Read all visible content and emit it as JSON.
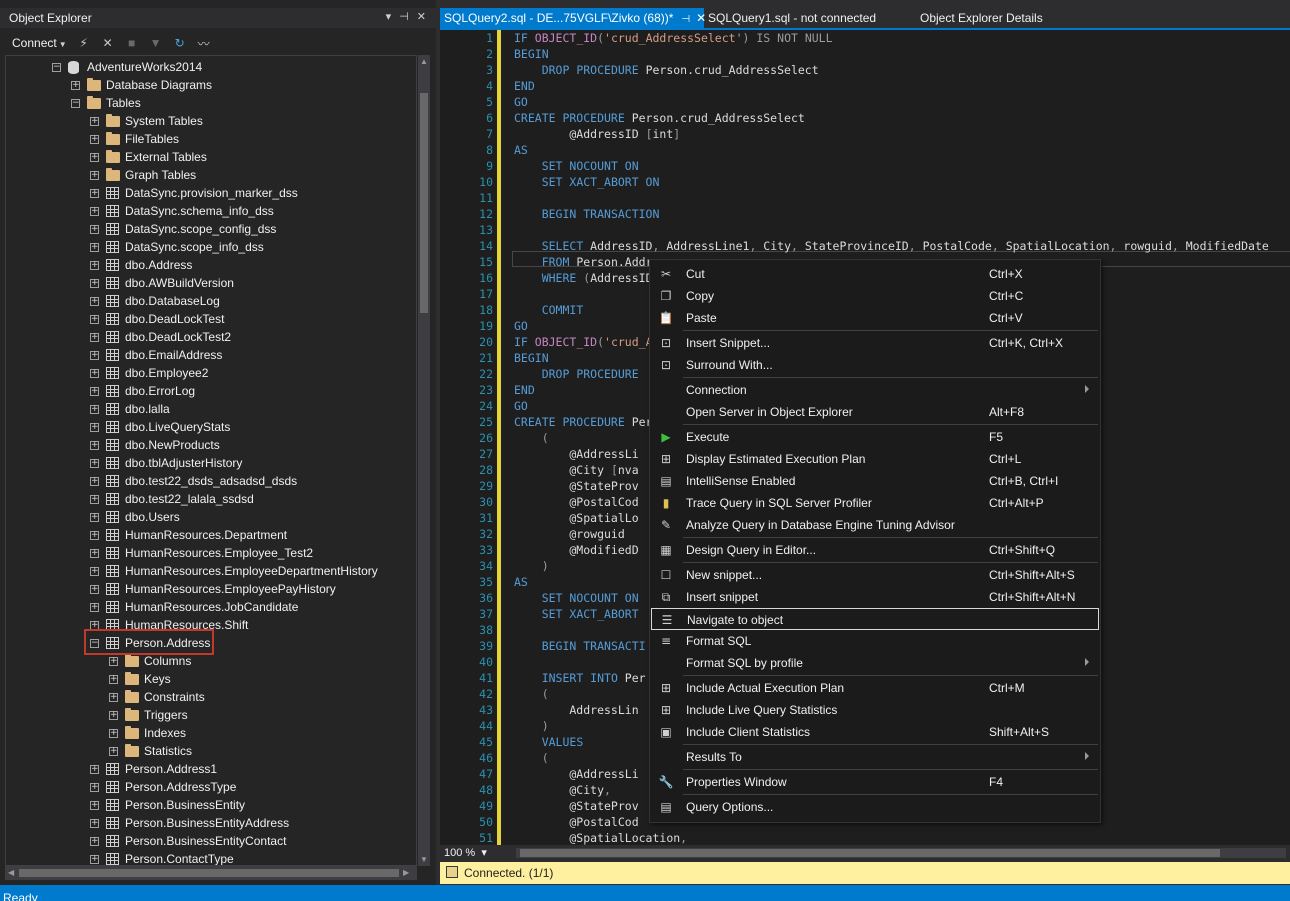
{
  "object_explorer": {
    "title": "Object Explorer",
    "pin_glyphs": [
      "▾",
      "⊣",
      "✕"
    ],
    "toolbar": {
      "connect_label": "Connect",
      "icons": [
        "connect-plug-icon",
        "disconnect-icon",
        "stop-icon",
        "filter-icon",
        "refresh-icon",
        "activity-monitor-icon"
      ]
    },
    "tree": [
      {
        "label": "AdventureWorks2014",
        "level": 0,
        "type": "db",
        "expander": "⊟"
      },
      {
        "label": "Database Diagrams",
        "level": 1,
        "type": "folder",
        "expander": "⊞"
      },
      {
        "label": "Tables",
        "level": 1,
        "type": "folder",
        "expander": "⊟"
      },
      {
        "label": "System Tables",
        "level": 2,
        "type": "folder",
        "expander": "⊞"
      },
      {
        "label": "FileTables",
        "level": 2,
        "type": "folder",
        "expander": "⊞"
      },
      {
        "label": "External Tables",
        "level": 2,
        "type": "folder",
        "expander": "⊞"
      },
      {
        "label": "Graph Tables",
        "level": 2,
        "type": "folder",
        "expander": "⊞"
      },
      {
        "label": "DataSync.provision_marker_dss",
        "level": 2,
        "type": "table",
        "expander": "⊞"
      },
      {
        "label": "DataSync.schema_info_dss",
        "level": 2,
        "type": "table",
        "expander": "⊞"
      },
      {
        "label": "DataSync.scope_config_dss",
        "level": 2,
        "type": "table",
        "expander": "⊞"
      },
      {
        "label": "DataSync.scope_info_dss",
        "level": 2,
        "type": "table",
        "expander": "⊞"
      },
      {
        "label": "dbo.Address",
        "level": 2,
        "type": "table",
        "expander": "⊞"
      },
      {
        "label": "dbo.AWBuildVersion",
        "level": 2,
        "type": "table",
        "expander": "⊞"
      },
      {
        "label": "dbo.DatabaseLog",
        "level": 2,
        "type": "table",
        "expander": "⊞"
      },
      {
        "label": "dbo.DeadLockTest",
        "level": 2,
        "type": "table",
        "expander": "⊞"
      },
      {
        "label": "dbo.DeadLockTest2",
        "level": 2,
        "type": "table",
        "expander": "⊞"
      },
      {
        "label": "dbo.EmailAddress",
        "level": 2,
        "type": "table",
        "expander": "⊞"
      },
      {
        "label": "dbo.Employee2",
        "level": 2,
        "type": "table",
        "expander": "⊞"
      },
      {
        "label": "dbo.ErrorLog",
        "level": 2,
        "type": "table",
        "expander": "⊞"
      },
      {
        "label": "dbo.lalla",
        "level": 2,
        "type": "table",
        "expander": "⊞"
      },
      {
        "label": "dbo.LiveQueryStats",
        "level": 2,
        "type": "table",
        "expander": "⊞"
      },
      {
        "label": "dbo.NewProducts",
        "level": 2,
        "type": "table",
        "expander": "⊞"
      },
      {
        "label": "dbo.tblAdjusterHistory",
        "level": 2,
        "type": "table",
        "expander": "⊞"
      },
      {
        "label": "dbo.test22_dsds_adsadsd_dsds",
        "level": 2,
        "type": "table",
        "expander": "⊞"
      },
      {
        "label": "dbo.test22_lalala_ssdsd",
        "level": 2,
        "type": "table",
        "expander": "⊞"
      },
      {
        "label": "dbo.Users",
        "level": 2,
        "type": "table",
        "expander": "⊞"
      },
      {
        "label": "HumanResources.Department",
        "level": 2,
        "type": "table",
        "expander": "⊞"
      },
      {
        "label": "HumanResources.Employee_Test2",
        "level": 2,
        "type": "table",
        "expander": "⊞"
      },
      {
        "label": "HumanResources.EmployeeDepartmentHistory",
        "level": 2,
        "type": "table",
        "expander": "⊞"
      },
      {
        "label": "HumanResources.EmployeePayHistory",
        "level": 2,
        "type": "table",
        "expander": "⊞"
      },
      {
        "label": "HumanResources.JobCandidate",
        "level": 2,
        "type": "table",
        "expander": "⊞"
      },
      {
        "label": "HumanResources.Shift",
        "level": 2,
        "type": "table",
        "expander": "⊞"
      },
      {
        "label": "Person.Address",
        "level": 2,
        "type": "table",
        "expander": "⊟",
        "selected": true
      },
      {
        "label": "Columns",
        "level": 3,
        "type": "folder",
        "expander": "⊞"
      },
      {
        "label": "Keys",
        "level": 3,
        "type": "folder",
        "expander": "⊞"
      },
      {
        "label": "Constraints",
        "level": 3,
        "type": "folder",
        "expander": "⊞"
      },
      {
        "label": "Triggers",
        "level": 3,
        "type": "folder",
        "expander": "⊞"
      },
      {
        "label": "Indexes",
        "level": 3,
        "type": "folder",
        "expander": "⊞"
      },
      {
        "label": "Statistics",
        "level": 3,
        "type": "folder",
        "expander": "⊞"
      },
      {
        "label": "Person.Address1",
        "level": 2,
        "type": "table",
        "expander": "⊞"
      },
      {
        "label": "Person.AddressType",
        "level": 2,
        "type": "table",
        "expander": "⊞"
      },
      {
        "label": "Person.BusinessEntity",
        "level": 2,
        "type": "table",
        "expander": "⊞"
      },
      {
        "label": "Person.BusinessEntityAddress",
        "level": 2,
        "type": "table",
        "expander": "⊞"
      },
      {
        "label": "Person.BusinessEntityContact",
        "level": 2,
        "type": "table",
        "expander": "⊞"
      },
      {
        "label": "Person.ContactType",
        "level": 2,
        "type": "table",
        "expander": "⊞"
      }
    ]
  },
  "tabs": [
    {
      "label": "SQLQuery2.sql - DE...75VGLF\\Zivko (68))*",
      "active": true,
      "pin": "⊣",
      "close": "✕"
    },
    {
      "label": "SQLQuery1.sql - not connected",
      "active": false
    },
    {
      "label": "Object Explorer Details",
      "active": false
    }
  ],
  "editor": {
    "lines": [
      [
        [
          "kw",
          "IF "
        ],
        [
          "fn",
          "OBJECT_ID"
        ],
        [
          "gr",
          "("
        ],
        [
          "str",
          "'crud_AddressSelect'"
        ],
        [
          "gr",
          ") "
        ],
        [
          "gr",
          "IS NOT NULL"
        ]
      ],
      [
        [
          "kw",
          "BEGIN"
        ]
      ],
      [
        [
          "id",
          "    "
        ],
        [
          "kw",
          "DROP PROCEDURE "
        ],
        [
          "id",
          "Person.crud_AddressSelect"
        ]
      ],
      [
        [
          "kw",
          "END"
        ]
      ],
      [
        [
          "kw",
          "GO"
        ]
      ],
      [
        [
          "kw",
          "CREATE PROCEDURE "
        ],
        [
          "id",
          "Person.crud_AddressSelect"
        ]
      ],
      [
        [
          "id",
          "        @AddressID "
        ],
        [
          "gr",
          "["
        ],
        [
          "id",
          "int"
        ],
        [
          "gr",
          "]"
        ]
      ],
      [
        [
          "kw",
          "AS"
        ]
      ],
      [
        [
          "id",
          "    "
        ],
        [
          "kw",
          "SET NOCOUNT ON"
        ]
      ],
      [
        [
          "id",
          "    "
        ],
        [
          "kw",
          "SET XACT_ABORT ON"
        ]
      ],
      [
        [
          "id",
          ""
        ]
      ],
      [
        [
          "id",
          "    "
        ],
        [
          "kw",
          "BEGIN TRANSACTION"
        ]
      ],
      [
        [
          "id",
          ""
        ]
      ],
      [
        [
          "id",
          "    "
        ],
        [
          "kw",
          "SELECT "
        ],
        [
          "id",
          "AddressID"
        ],
        [
          "gr",
          ", "
        ],
        [
          "id",
          "AddressLine1"
        ],
        [
          "gr",
          ", "
        ],
        [
          "id",
          "City"
        ],
        [
          "gr",
          ", "
        ],
        [
          "id",
          "StateProvinceID"
        ],
        [
          "gr",
          ", "
        ],
        [
          "id",
          "PostalCode"
        ],
        [
          "gr",
          ", "
        ],
        [
          "id",
          "SpatialLocation"
        ],
        [
          "gr",
          ", "
        ],
        [
          "id",
          "rowguid"
        ],
        [
          "gr",
          ", "
        ],
        [
          "id",
          "ModifiedDate"
        ]
      ],
      [
        [
          "id",
          "    "
        ],
        [
          "kw",
          "FROM "
        ],
        [
          "id",
          "Person.Address"
        ]
      ],
      [
        [
          "id",
          "    "
        ],
        [
          "kw",
          "WHERE "
        ],
        [
          "gr",
          "("
        ],
        [
          "id",
          "AddressID"
        ]
      ],
      [
        [
          "id",
          ""
        ]
      ],
      [
        [
          "id",
          "    "
        ],
        [
          "kw",
          "COMMIT"
        ]
      ],
      [
        [
          "kw",
          "GO"
        ]
      ],
      [
        [
          "kw",
          "IF "
        ],
        [
          "fn",
          "OBJECT_ID"
        ],
        [
          "gr",
          "("
        ],
        [
          "str",
          "'crud_A"
        ]
      ],
      [
        [
          "kw",
          "BEGIN"
        ]
      ],
      [
        [
          "id",
          "    "
        ],
        [
          "kw",
          "DROP PROCEDURE"
        ]
      ],
      [
        [
          "kw",
          "END"
        ]
      ],
      [
        [
          "kw",
          "GO"
        ]
      ],
      [
        [
          "kw",
          "CREATE PROCEDURE "
        ],
        [
          "id",
          "Pers"
        ]
      ],
      [
        [
          "id",
          "    "
        ],
        [
          "gr",
          "("
        ]
      ],
      [
        [
          "id",
          "        @AddressLi"
        ]
      ],
      [
        [
          "id",
          "        @City "
        ],
        [
          "gr",
          "["
        ],
        [
          "id",
          "nva"
        ]
      ],
      [
        [
          "id",
          "        @StateProv"
        ]
      ],
      [
        [
          "id",
          "        @PostalCod"
        ]
      ],
      [
        [
          "id",
          "        @SpatialLo"
        ]
      ],
      [
        [
          "id",
          "        @rowguid"
        ]
      ],
      [
        [
          "id",
          "        @ModifiedD"
        ]
      ],
      [
        [
          "id",
          "    "
        ],
        [
          "gr",
          ")"
        ]
      ],
      [
        [
          "kw",
          "AS"
        ]
      ],
      [
        [
          "id",
          "    "
        ],
        [
          "kw",
          "SET NOCOUNT ON"
        ]
      ],
      [
        [
          "id",
          "    "
        ],
        [
          "kw",
          "SET XACT_ABORT"
        ]
      ],
      [
        [
          "id",
          ""
        ]
      ],
      [
        [
          "id",
          "    "
        ],
        [
          "kw",
          "BEGIN TRANSACTI"
        ]
      ],
      [
        [
          "id",
          ""
        ]
      ],
      [
        [
          "id",
          "    "
        ],
        [
          "kw",
          "INSERT INTO "
        ],
        [
          "id",
          "Per"
        ]
      ],
      [
        [
          "id",
          "    "
        ],
        [
          "gr",
          "("
        ]
      ],
      [
        [
          "id",
          "        AddressLin                                                    ModifiedDate"
        ]
      ],
      [
        [
          "id",
          "    "
        ],
        [
          "gr",
          ")"
        ]
      ],
      [
        [
          "id",
          "    "
        ],
        [
          "kw",
          "VALUES"
        ]
      ],
      [
        [
          "id",
          "    "
        ],
        [
          "gr",
          "("
        ]
      ],
      [
        [
          "id",
          "        @AddressLi"
        ]
      ],
      [
        [
          "id",
          "        @City"
        ],
        [
          "gr",
          ","
        ]
      ],
      [
        [
          "id",
          "        @StateProv"
        ]
      ],
      [
        [
          "id",
          "        @PostalCod"
        ]
      ],
      [
        [
          "id",
          "        @SpatialLocation"
        ],
        [
          "gr",
          ","
        ]
      ]
    ]
  },
  "zoom": {
    "label": "100 %",
    "caret": "▾"
  },
  "connection_bar": {
    "text": "Connected. (1/1)"
  },
  "status_bar": {
    "text": "Ready"
  },
  "context_menu": {
    "items": [
      {
        "label": "Cut",
        "shortcut": "Ctrl+X",
        "icon": "scissors-icon",
        "glyph": "✂"
      },
      {
        "label": "Copy",
        "shortcut": "Ctrl+C",
        "icon": "copy-icon",
        "glyph": "❐"
      },
      {
        "label": "Paste",
        "shortcut": "Ctrl+V",
        "icon": "paste-icon",
        "glyph": "📋"
      },
      {
        "sep": true
      },
      {
        "label": "Insert Snippet...",
        "shortcut": "Ctrl+K, Ctrl+X",
        "icon": "insert-snippet-icon",
        "glyph": "⊡"
      },
      {
        "label": "Surround With...",
        "shortcut": "",
        "icon": "surround-with-icon",
        "glyph": "⊡"
      },
      {
        "sep": true
      },
      {
        "label": "Connection",
        "shortcut": "",
        "submenu": true
      },
      {
        "label": "Open Server in Object Explorer",
        "shortcut": "Alt+F8"
      },
      {
        "sep": true
      },
      {
        "label": "Execute",
        "shortcut": "F5",
        "icon": "execute-icon",
        "glyph": "▶",
        "color": "#3fbf3f"
      },
      {
        "label": "Display Estimated Execution Plan",
        "shortcut": "Ctrl+L",
        "icon": "estimated-plan-icon",
        "glyph": "⊞"
      },
      {
        "label": "IntelliSense Enabled",
        "shortcut": "Ctrl+B, Ctrl+I",
        "icon": "intellisense-icon",
        "glyph": "▤"
      },
      {
        "label": "Trace Query in SQL Server Profiler",
        "shortcut": "Ctrl+Alt+P",
        "icon": "profiler-icon",
        "glyph": "▮",
        "color": "#e0c050"
      },
      {
        "label": "Analyze Query in Database Engine Tuning Advisor",
        "shortcut": "",
        "icon": "tuning-advisor-icon",
        "glyph": "✎"
      },
      {
        "sep": true
      },
      {
        "label": "Design Query in Editor...",
        "shortcut": "Ctrl+Shift+Q",
        "icon": "design-query-icon",
        "glyph": "▦"
      },
      {
        "sep": true
      },
      {
        "label": "New snippet...",
        "shortcut": "Ctrl+Shift+Alt+S",
        "icon": "new-snippet-icon",
        "glyph": "☐"
      },
      {
        "label": "Insert snippet",
        "shortcut": "Ctrl+Shift+Alt+N",
        "icon": "insert-snippet2-icon",
        "glyph": "⧉"
      },
      {
        "label": "Navigate to object",
        "shortcut": "",
        "icon": "navigate-object-icon",
        "glyph": "☰",
        "highlight": true
      },
      {
        "label": "Format SQL",
        "shortcut": "",
        "icon": "format-sql-icon",
        "glyph": "≡"
      },
      {
        "label": "Format SQL by profile",
        "shortcut": "",
        "submenu": true
      },
      {
        "sep": true
      },
      {
        "label": "Include Actual Execution Plan",
        "shortcut": "Ctrl+M",
        "icon": "actual-plan-icon",
        "glyph": "⊞"
      },
      {
        "label": "Include Live Query Statistics",
        "shortcut": "",
        "icon": "live-stats-icon",
        "glyph": "⊞"
      },
      {
        "label": "Include Client Statistics",
        "shortcut": "Shift+Alt+S",
        "icon": "client-stats-icon",
        "glyph": "▣"
      },
      {
        "sep": true
      },
      {
        "label": "Results To",
        "shortcut": "",
        "submenu": true
      },
      {
        "sep": true
      },
      {
        "label": "Properties Window",
        "shortcut": "F4",
        "icon": "wrench-icon",
        "glyph": "🔧"
      },
      {
        "sep": true
      },
      {
        "label": "Query Options...",
        "shortcut": "",
        "icon": "query-options-icon",
        "glyph": "▤"
      }
    ]
  }
}
